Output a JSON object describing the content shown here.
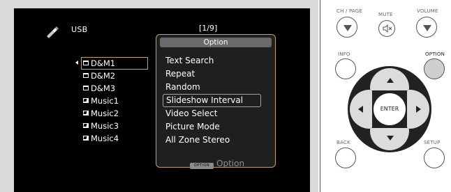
{
  "screen": {
    "source_label": "USB",
    "page_indicator": "[1/9]",
    "files": [
      {
        "name": "D&M1",
        "type": "folder",
        "selected": true
      },
      {
        "name": "D&M2",
        "type": "folder",
        "selected": false
      },
      {
        "name": "D&M3",
        "type": "folder",
        "selected": false
      },
      {
        "name": "Music1",
        "type": "music",
        "selected": false
      },
      {
        "name": "Music2",
        "type": "music",
        "selected": false
      },
      {
        "name": "Music3",
        "type": "music",
        "selected": false
      },
      {
        "name": "Music4",
        "type": "music",
        "selected": false
      }
    ],
    "option_menu": {
      "title": "Option",
      "items": [
        "Text Search",
        "Repeat",
        "Random",
        "Slideshow Interval",
        "Video Select",
        "Picture Mode",
        "All Zone Stereo"
      ],
      "selected_index": 3
    },
    "footer": {
      "key_badge": "OPTION",
      "key_label": "Option"
    }
  },
  "remote": {
    "labels": {
      "ch_page": "CH / PAGE",
      "mute": "MUTE",
      "volume": "VOLUME",
      "info": "INFO",
      "option": "OPTION",
      "enter": "ENTER",
      "back": "BACK",
      "setup": "SETUP"
    }
  },
  "colors": {
    "highlight": "#c9a259",
    "screen_bg": "#000000",
    "frame_bg": "#d9d9d9",
    "popup_bg": "#1f1f1f"
  }
}
